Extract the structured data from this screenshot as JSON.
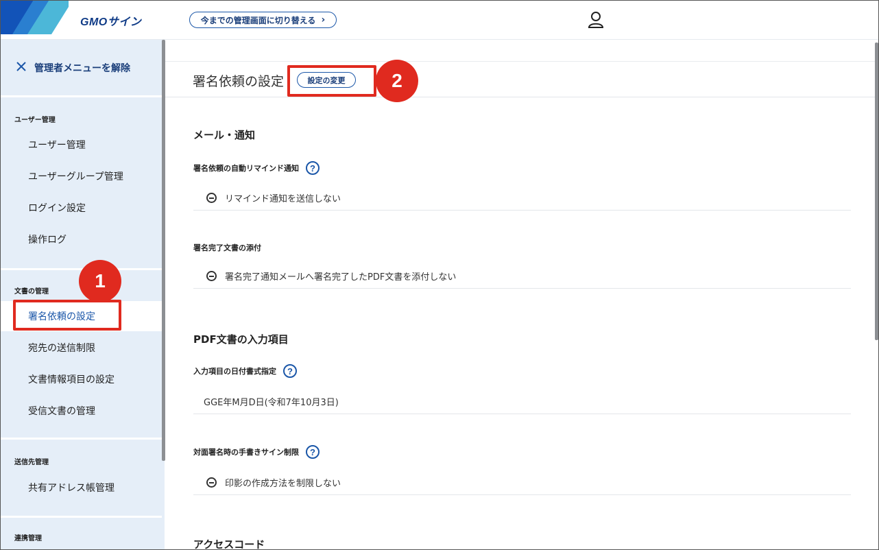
{
  "header": {
    "brand": "GMOサイン",
    "switch_button": "今までの管理画面に切り替える",
    "switch_chevron": "›",
    "user_icon": "user-icon"
  },
  "sidebar": {
    "release_label": "管理者メニューを解除",
    "sections": [
      {
        "title": "ユーザー管理",
        "items": [
          "ユーザー管理",
          "ユーザーグループ管理",
          "ログイン設定",
          "操作ログ"
        ]
      },
      {
        "title": "文書の管理",
        "items": [
          "署名依頼の設定",
          "宛先の送信制限",
          "文書情報項目の設定",
          "受信文書の管理"
        ]
      },
      {
        "title": "送信先管理",
        "items": [
          "共有アドレス帳管理"
        ]
      },
      {
        "title": "連携管理",
        "items": []
      }
    ],
    "active_item": "署名依頼の設定"
  },
  "main": {
    "page_title": "署名依頼の設定",
    "change_button": "設定の変更",
    "mail_section": {
      "title": "メール・通知",
      "reminder_label": "署名依頼の自動リマインド通知",
      "reminder_value": "リマインド通知を送信しない",
      "attach_label": "署名完了文書の添付",
      "attach_value": "署名完了通知メールへ署名完了したPDF文書を添付しない"
    },
    "pdf_section": {
      "title": "PDF文書の入力項目",
      "date_label": "入力項目の日付書式指定",
      "date_value": "GGE年M月D日(令和7年10月3日)",
      "handwrite_label": "対面署名時の手書きサイン制限",
      "handwrite_value": "印影の作成方法を制限しない"
    },
    "access_section": {
      "title": "アクセスコード"
    },
    "help_glyph": "?"
  },
  "annotations": {
    "badge1": "1",
    "badge2": "2",
    "color": "#e02a1f"
  }
}
